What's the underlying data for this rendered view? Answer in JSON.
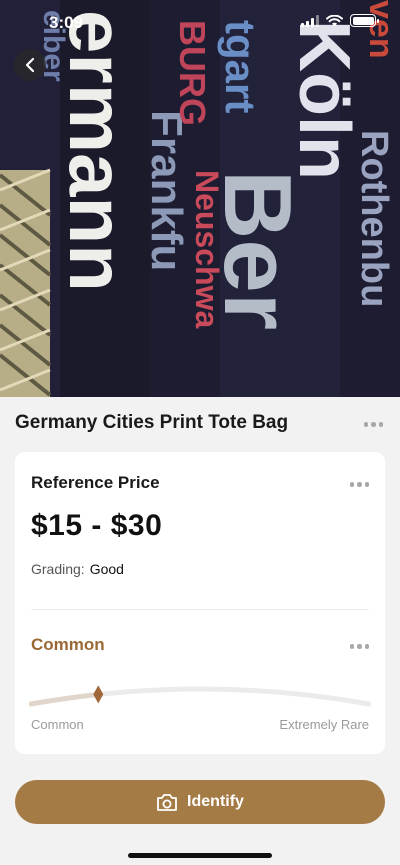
{
  "status_bar": {
    "time": "3:09",
    "battery_level": 1.0
  },
  "item": {
    "title": "Germany Cities Print Tote Bag"
  },
  "price_section": {
    "heading": "Reference Price",
    "price": "$15 - $30",
    "grading_label": "Grading:",
    "grading_value": "Good"
  },
  "rarity_section": {
    "heading": "Common",
    "scale_min_label": "Common",
    "scale_max_label": "Extremely Rare",
    "level": 0.2
  },
  "actions": {
    "identify_label": "Identify"
  },
  "colors": {
    "accent": "#a47a45",
    "rarity_text": "#9a6a36",
    "background": "#f2f2f2",
    "card": "#ffffff"
  }
}
